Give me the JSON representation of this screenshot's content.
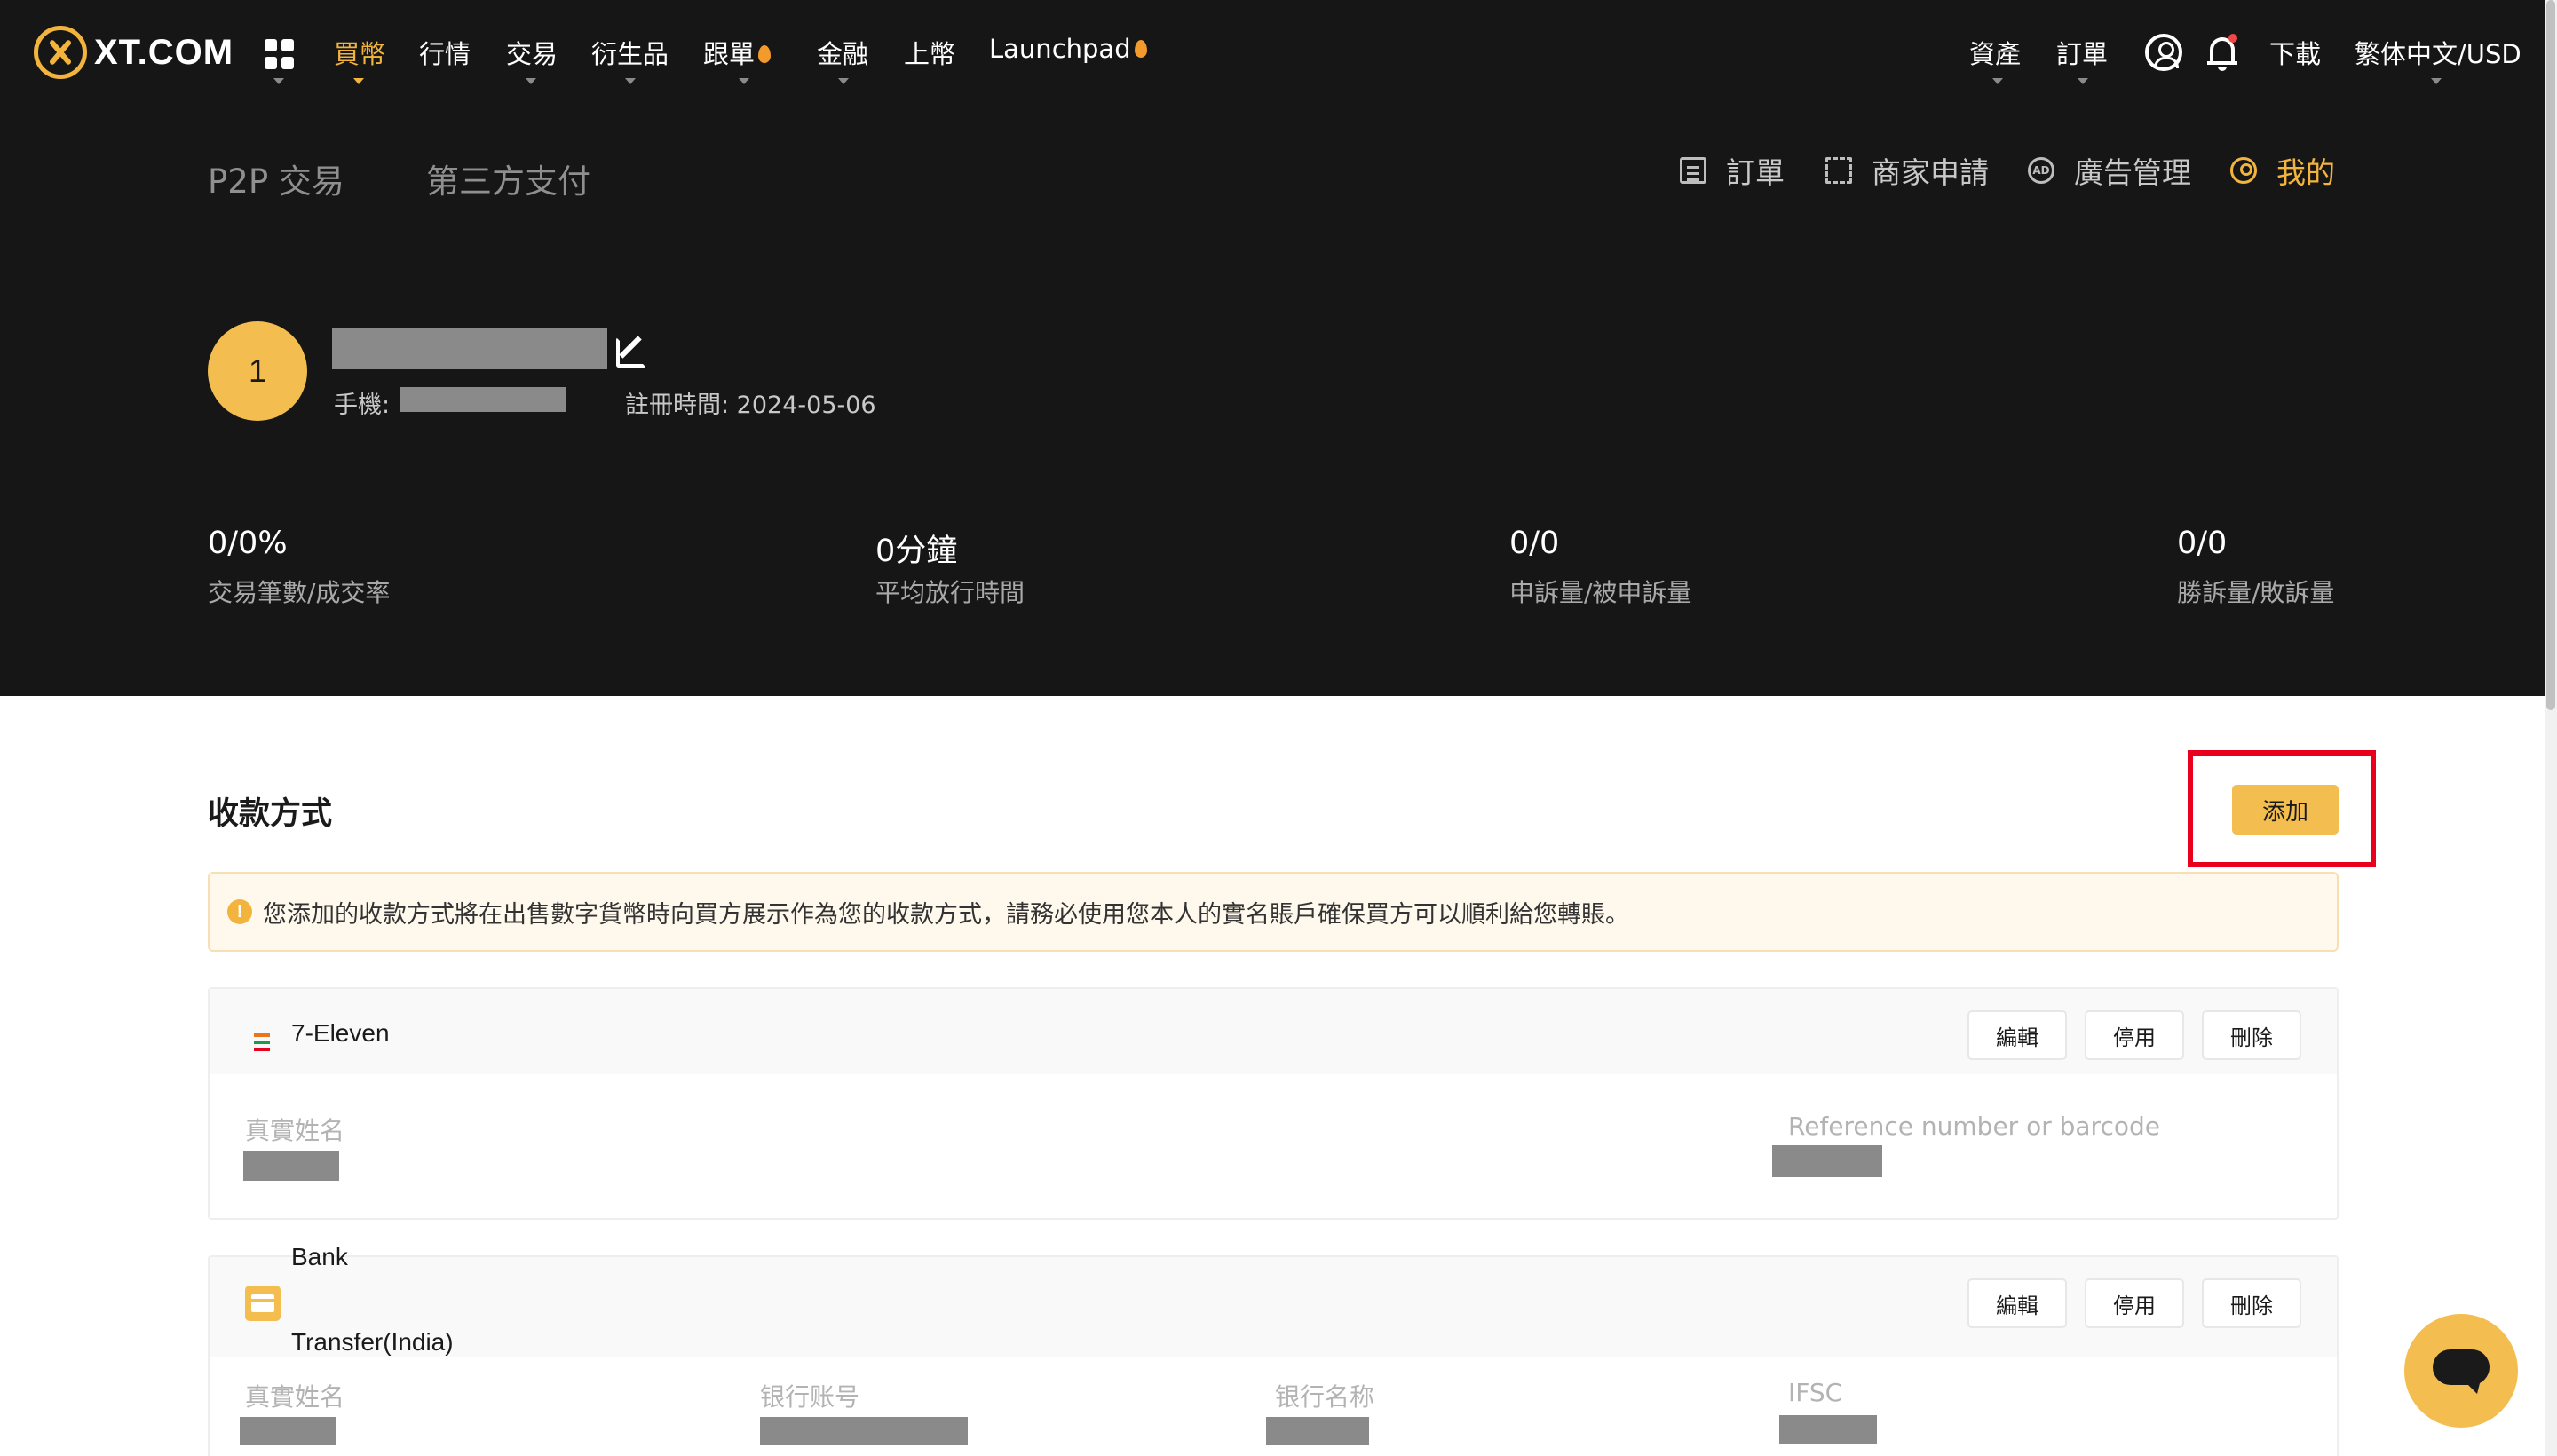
{
  "nav": {
    "logo_text": "XT.COM",
    "items": [
      {
        "label": "買幣",
        "active": true,
        "caret": true
      },
      {
        "label": "行情",
        "caret": false
      },
      {
        "label": "交易",
        "caret": true
      },
      {
        "label": "衍生品",
        "caret": true
      },
      {
        "label": "跟單",
        "caret": true,
        "hot": true
      },
      {
        "label": "金融",
        "caret": true
      },
      {
        "label": "上幣",
        "caret": false
      },
      {
        "label": "Launchpad",
        "hot": true
      }
    ],
    "right": {
      "assets": "資產",
      "orders": "訂單",
      "download": "下載",
      "language": "繁体中文/USD"
    }
  },
  "p2p": {
    "tabs": [
      "P2P 交易",
      "第三方支付"
    ],
    "links": {
      "orders": "訂單",
      "merchant_apply": "商家申請",
      "ad_manage": "廣告管理",
      "mine": "我的"
    }
  },
  "profile": {
    "avatar_initial": "1",
    "phone_label": "手機:",
    "register_label": "註冊時間: 2024-05-06"
  },
  "stats": [
    {
      "value": "0/0%",
      "label": "交易筆數/成交率"
    },
    {
      "value": "0分鐘",
      "label": "平均放行時間"
    },
    {
      "value": "0/0",
      "label": "申訴量/被申訴量"
    },
    {
      "value": "0/0",
      "label": "勝訴量/敗訴量"
    }
  ],
  "payment": {
    "title": "收款方式",
    "add_label": "添加",
    "notice": "您添加的收款方式將在出售數字貨幣時向買方展示作為您的收款方式，請務必使用您本人的實名賬戶確保買方可以順利給您轉賬。",
    "methods": [
      {
        "name": "7-Eleven",
        "edit": "編輯",
        "disable": "停用",
        "delete": "刪除",
        "fields": [
          "真實姓名",
          "Reference number or barcode"
        ]
      },
      {
        "name_line1": "Bank",
        "name_line2": "Transfer(India)",
        "edit": "編輯",
        "disable": "停用",
        "delete": "刪除",
        "fields": [
          "真實姓名",
          "银行账号",
          "银行名称",
          "IFSC"
        ]
      }
    ]
  },
  "colors": {
    "brand": "#f2b43d",
    "dark_bg": "#161616",
    "highlight_border": "#e8001c"
  }
}
